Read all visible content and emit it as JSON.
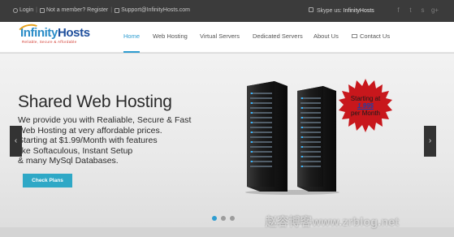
{
  "topbar": {
    "login": "Login",
    "not_member": "Not a member?",
    "register": "Register",
    "support_email": "Support@InfinityHosts.com",
    "skype_label": "Skype us:",
    "skype_name": "InfinityHosts",
    "social_icons": [
      "facebook-icon",
      "twitter-icon",
      "skype-icon",
      "google-plus-icon"
    ],
    "social_glyphs": [
      "f",
      "t",
      "s",
      "g+"
    ]
  },
  "logo": {
    "name_infinity": "Infinity",
    "name_hosts": "Hosts",
    "tagline": "Reliable, Secure & Affordable"
  },
  "nav": [
    {
      "label": "Home",
      "active": true
    },
    {
      "label": "Web Hosting",
      "active": false
    },
    {
      "label": "Virtual Servers",
      "active": false
    },
    {
      "label": "Dedicated Servers",
      "active": false
    },
    {
      "label": "About Us",
      "active": false
    },
    {
      "label": "Contact Us",
      "active": false
    }
  ],
  "hero": {
    "title": "Shared Web Hosting",
    "description_lines": [
      "We provide you with Realiable, Secure & Fast",
      "Web Hosting at very affordable prices.",
      "Starting at $1.99/Month with features",
      "like Softaculous, Instant Setup",
      "& many MySql Databases."
    ],
    "cta_label": "Check Plans",
    "badge_line1": "Starting at",
    "badge_price": "1.99$",
    "badge_line3": "per Month",
    "prev_glyph": "‹",
    "next_glyph": "›"
  },
  "carousel": {
    "slide_count": 3,
    "active_index": 0
  },
  "watermark": "赵容博客www.zrblog.net",
  "colors": {
    "accent": "#2f9dd1",
    "cta": "#2fa8c6",
    "badge_red": "#c8171c",
    "topbar_bg": "#3b3b3b"
  }
}
